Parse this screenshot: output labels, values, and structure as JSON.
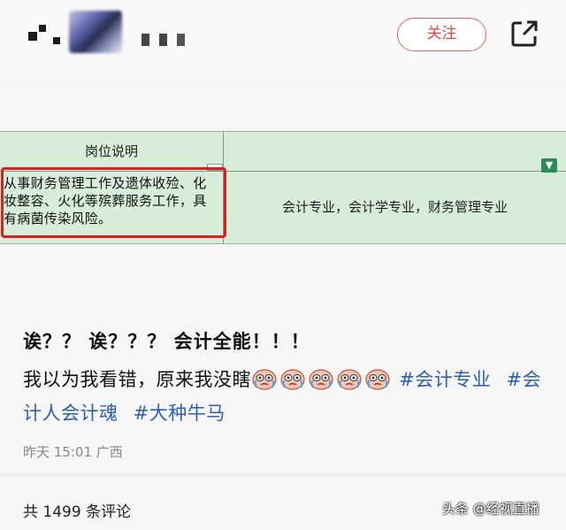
{
  "header": {
    "follow_label": "关注",
    "share_icon": "share-icon"
  },
  "sheet": {
    "header_label": "岗位说明",
    "description": "从事财务管理工作及遗体收殓、化妆整容、火化等殡葬服务工作，具有病菌传染风险。",
    "major": "会计专业，会计学专业，财务管理专业",
    "filter_icon": "filter-icon",
    "highlight_color": "#d8201e",
    "cell_color": "#d7ecd9"
  },
  "post": {
    "title": "诶？？ 诶？？？ 会计全能！！！",
    "text_before_emoji": "我以为我看错，原来我没瞎",
    "emoji_count": 5,
    "emoji_name": "crying-face-emoji",
    "hashtags": [
      "#会计专业",
      "#会计人会计魂",
      "#大种牛马"
    ],
    "time": "昨天 15:01",
    "location": "广西",
    "hashtag_color": "#2e5fb0"
  },
  "footer": {
    "comments": "共 1499 条评论",
    "watermark": "头条 @经视直播"
  }
}
